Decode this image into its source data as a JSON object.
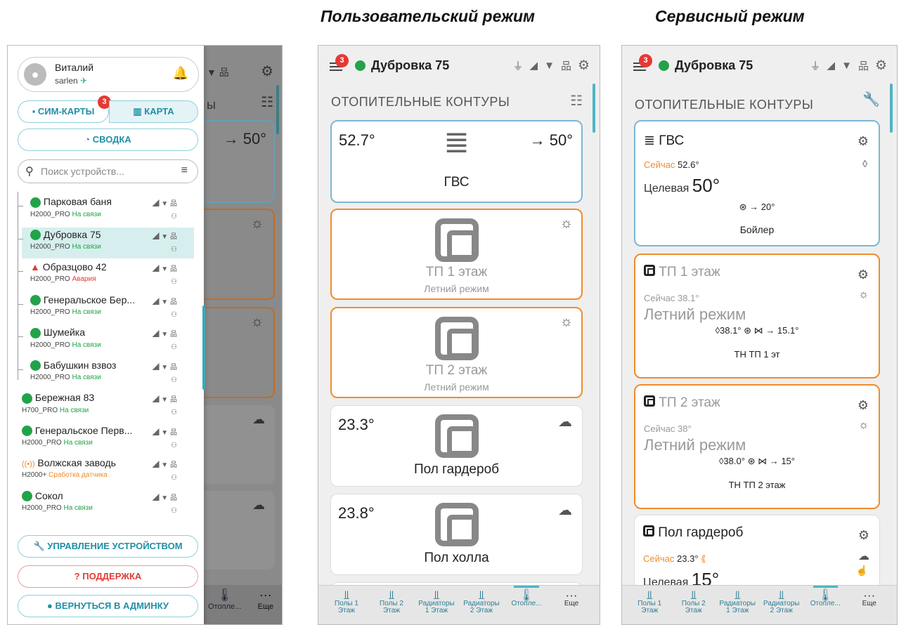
{
  "headings": {
    "user_mode": "Пользовательский режим",
    "service_mode": "Сервисный режим"
  },
  "drawer": {
    "user_name": "Виталий",
    "user_login": "sarlen",
    "sim_label": "СИМ-КАРТЫ",
    "sim_badge": "3",
    "map_label": "КАРТА",
    "summary_label": "СВОДКА",
    "search_placeholder": "Поиск устройств...",
    "devices": [
      {
        "name": "Парковая баня",
        "model": "H2000_PRO",
        "status": "На связи",
        "kind": "ok"
      },
      {
        "name": "Дубровка 75",
        "model": "H2000_PRO",
        "status": "На связи",
        "kind": "ok"
      },
      {
        "name": "Образцово 42",
        "model": "H2000_PRO",
        "status": "Авария",
        "kind": "err"
      },
      {
        "name": "Генеральское Бер...",
        "model": "H2000_PRO",
        "status": "На связи",
        "kind": "ok"
      },
      {
        "name": "Шумейка",
        "model": "H2000_PRO",
        "status": "На связи",
        "kind": "ok"
      },
      {
        "name": "Бабушкин взвоз",
        "model": "H2000_PRO",
        "status": "На связи",
        "kind": "ok"
      },
      {
        "name": "Бережная 83",
        "model": "H700_PRO",
        "status": "На связи",
        "kind": "ok"
      },
      {
        "name": "Генеральское Перв...",
        "model": "H2000_PRO",
        "status": "На связи",
        "kind": "ok"
      },
      {
        "name": "Волжская заводь",
        "model": "H2000+",
        "status": "Сработка датчика",
        "kind": "warn"
      },
      {
        "name": "Сокол",
        "model": "H2000_PRO",
        "status": "На связи",
        "kind": "ok"
      }
    ],
    "manage_label": "УПРАВЛЕНИЕ УСТРОЙСТВОМ",
    "support_label": "ПОДДЕРЖКА",
    "admin_label": "ВЕРНУТЬСЯ В АДМИНКУ",
    "bg_temp": "→ 50°",
    "bg_partial_title": "ы",
    "bg_tab": "Отопле...",
    "bg_more": "Еще"
  },
  "user": {
    "device_title": "Дубровка 75",
    "badge": "3",
    "section": "ОТОПИТЕЛЬНЫЕ КОНТУРЫ",
    "cards": [
      {
        "temp": "52.7°",
        "target": "→ 50°",
        "name": "ГВС",
        "sub": ""
      },
      {
        "temp": "",
        "target": "",
        "name": "ТП 1 этаж",
        "sub": "Летний режим"
      },
      {
        "temp": "",
        "target": "",
        "name": "ТП 2 этаж",
        "sub": "Летний режим"
      },
      {
        "temp": "23.3°",
        "target": "",
        "name": "Пол гардероб",
        "sub": ""
      },
      {
        "temp": "23.8°",
        "target": "",
        "name": "Пол холла",
        "sub": ""
      }
    ]
  },
  "service": {
    "device_title": "Дубровка 75",
    "badge": "3",
    "section": "ОТОПИТЕЛЬНЫЕ КОНТУРЫ",
    "gvs": {
      "name": "ГВС",
      "now_label": "Сейчас",
      "now": "52.6°",
      "target_label": "Целевая",
      "target": "50°",
      "pump": "→ 20°",
      "device": "Бойлер"
    },
    "tp1": {
      "name": "ТП 1 этаж",
      "now_label": "Сейчас",
      "now": "38.1°",
      "mode": "Летний режим",
      "params": "38.1°",
      "out": "→ 15.1°",
      "device": "ТН ТП 1 эт"
    },
    "tp2": {
      "name": "ТП 2 этаж",
      "now_label": "Сейчас",
      "now": "38°",
      "mode": "Летний режим",
      "params": "38.0°",
      "out": "→ 15°",
      "device": "ТН ТП 2 этаж"
    },
    "pg": {
      "name": "Пол гардероб",
      "now_label": "Сейчас",
      "now": "23.3°",
      "target_label": "Целевая",
      "target": "15°"
    }
  },
  "tabs": [
    {
      "line1": "Полы 1",
      "line2": "Этаж"
    },
    {
      "line1": "Полы 2",
      "line2": "Этаж"
    },
    {
      "line1": "Радиаторы",
      "line2": "1 Этаж"
    },
    {
      "line1": "Радиаторы",
      "line2": "2 Этаж"
    },
    {
      "line1": "Отопле...",
      "line2": ""
    },
    {
      "line1": "Еще",
      "line2": ""
    }
  ]
}
